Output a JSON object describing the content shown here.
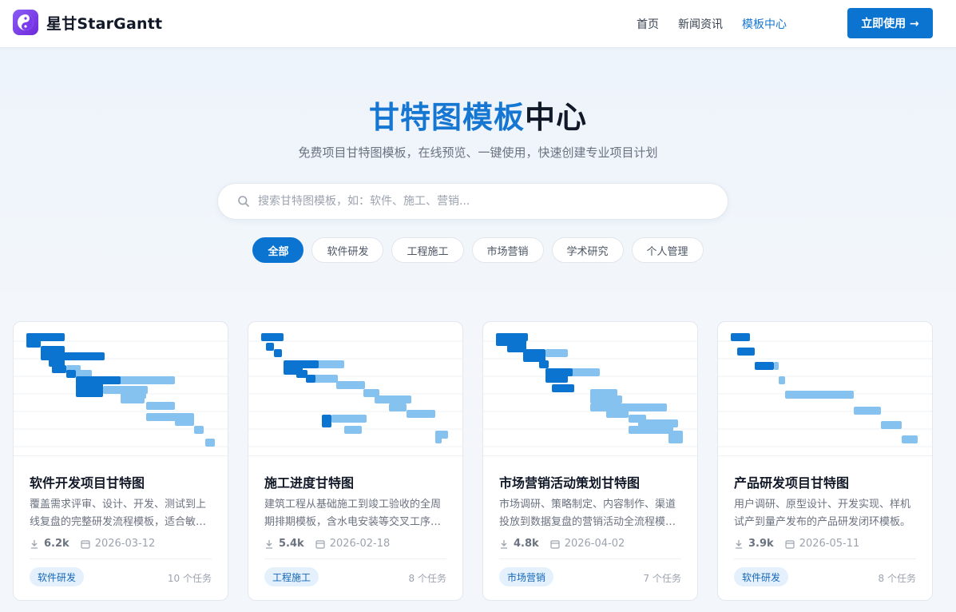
{
  "header": {
    "brand": "星甘StarGantt",
    "nav": [
      {
        "label": "首页",
        "active": false
      },
      {
        "label": "新闻资讯",
        "active": false
      },
      {
        "label": "模板中心",
        "active": true
      }
    ],
    "cta_label": "立即使用 →"
  },
  "hero": {
    "title_highlight": "甘特图模板",
    "title_rest": "中心",
    "subtitle": "免费项目甘特图模板，在线预览、一键使用，快速创建专业项目计划",
    "search_placeholder": "搜索甘特图模板，如：软件、施工、营销..."
  },
  "filters": [
    {
      "label": "全部",
      "active": true
    },
    {
      "label": "软件研发",
      "active": false
    },
    {
      "label": "工程施工",
      "active": false
    },
    {
      "label": "市场营销",
      "active": false
    },
    {
      "label": "学术研究",
      "active": false
    },
    {
      "label": "个人管理",
      "active": false
    }
  ],
  "colors": {
    "primary": "#0b74d1",
    "bar_dark": "#0b74d1",
    "bar_light": "#86c2f0"
  },
  "cards": [
    {
      "title": "软件开发项目甘特图",
      "desc": "覆盖需求评审、设计、开发、测试到上线复盘的完整研发流程模板，适合敏…",
      "downloads": "6.2k",
      "date": "2026-03-12",
      "tag": "软件研发",
      "tasks": "10 个任务"
    },
    {
      "title": "施工进度甘特图",
      "desc": "建筑工程从基础施工到竣工验收的全周期排期模板，含水电安装等交叉工序…",
      "downloads": "5.4k",
      "date": "2026-02-18",
      "tag": "工程施工",
      "tasks": "8 个任务"
    },
    {
      "title": "市场营销活动策划甘特图",
      "desc": "市场调研、策略制定、内容制作、渠道投放到数据复盘的营销活动全流程模…",
      "downloads": "4.8k",
      "date": "2026-04-02",
      "tag": "市场营销",
      "tasks": "7 个任务"
    },
    {
      "title": "产品研发项目甘特图",
      "desc": "用户调研、原型设计、开发实现、样机试产到量产发布的产品研发闭环模板。",
      "downloads": "3.9k",
      "date": "2026-05-11",
      "tag": "软件研发",
      "tasks": "8 个任务"
    }
  ]
}
